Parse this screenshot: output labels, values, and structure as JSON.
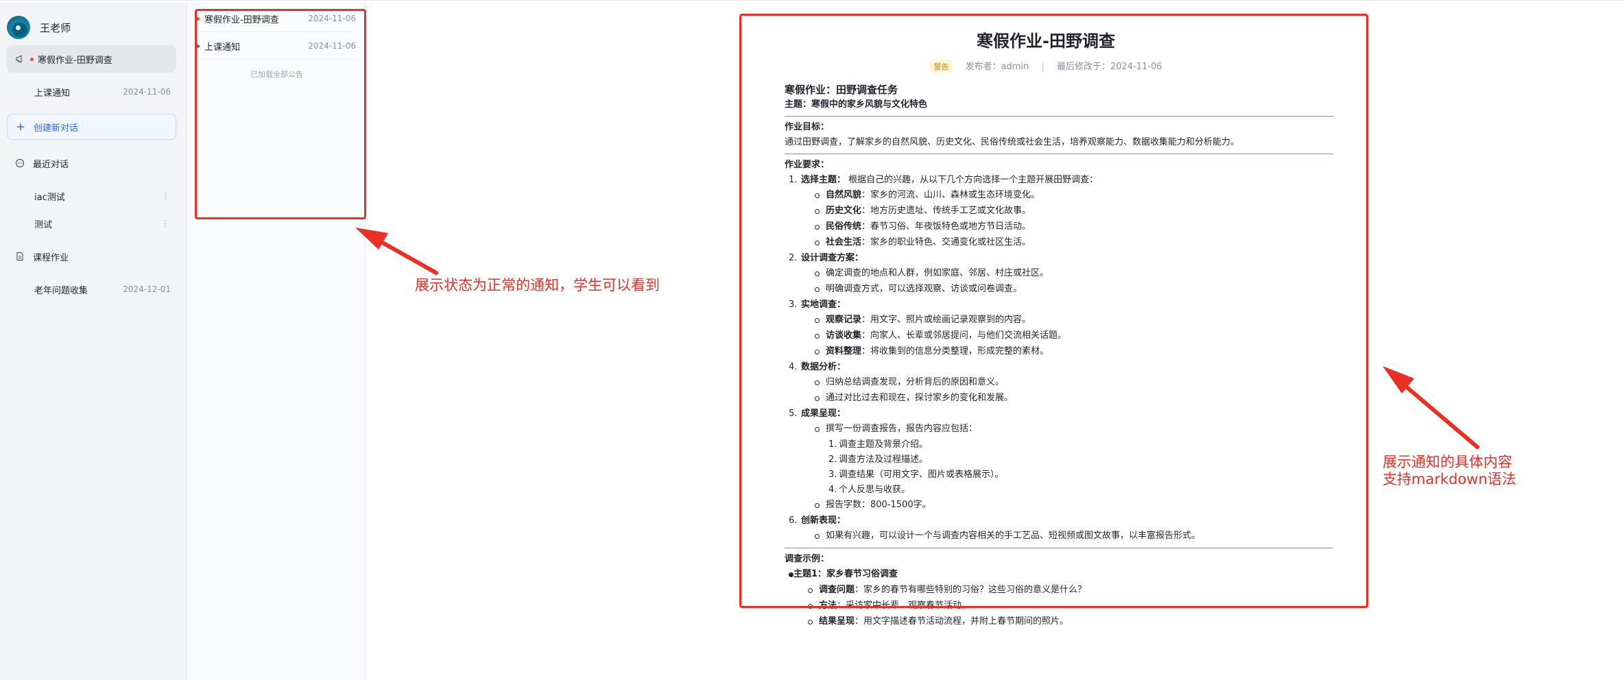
{
  "user": {
    "name": "王老师"
  },
  "sidebar": {
    "active_notice": {
      "label": "寒假作业-田野调查"
    },
    "notice_2": {
      "label": "上课通知",
      "date": "2024-11-06"
    },
    "new_chat": {
      "label": "创建新对话"
    },
    "recent": {
      "label": "最近对话"
    },
    "chats": [
      {
        "label": "iac测试"
      },
      {
        "label": "测试"
      }
    ],
    "homework": {
      "label": "课程作业"
    },
    "homework_item": {
      "label": "老年问题收集",
      "date": "2024-12-01"
    }
  },
  "notice_list": {
    "items": [
      {
        "title": "寒假作业-田野调查",
        "date": "2024-11-06",
        "dot_color": "#f04a2a"
      },
      {
        "title": "上课通知",
        "date": "2024-11-06",
        "dot_color": "#2f6bf1"
      }
    ],
    "loaded_text": "已加载全部公告"
  },
  "doc": {
    "title": "寒假作业-田野调查",
    "tag": "警告",
    "publisher": "发布者：admin",
    "modified": "最后修改于：2024-11-06",
    "h_task": "寒假作业：田野调查任务",
    "subject": "主题：寒假中的家乡风貌与文化特色",
    "goal_label": "作业目标：",
    "goal_text": "通过田野调查，了解家乡的自然风貌、历史文化、民俗传统或社会生活，培养观察能力、数据收集能力和分析能力。",
    "req_label": "作业要求：",
    "s1": {
      "num": "1.",
      "title": "选择主题：",
      "text": " 根据自己的兴趣，从以下几个方向选择一个主题开展田野调查：",
      "items": [
        {
          "b": "自然风貌",
          "t": "：家乡的河流、山川、森林或生态环境变化。"
        },
        {
          "b": "历史文化",
          "t": "：地方历史遗址、传统手工艺或文化故事。"
        },
        {
          "b": "民俗传统",
          "t": "：春节习俗、年夜饭特色或地方节日活动。"
        },
        {
          "b": "社会生活",
          "t": "：家乡的职业特色、交通变化或社区生活。"
        }
      ]
    },
    "s2": {
      "num": "2.",
      "title": "设计调查方案：",
      "items": [
        "确定调查的地点和人群，例如家庭、邻居、村庄或社区。",
        "明确调查方式，可以选择观察、访谈或问卷调查。"
      ]
    },
    "s3": {
      "num": "3.",
      "title": "实地调查：",
      "items": [
        {
          "b": "观察记录",
          "t": "：用文字、照片或绘画记录观察到的内容。"
        },
        {
          "b": "访谈收集",
          "t": "：向家人、长辈或邻居提问，与他们交流相关话题。"
        },
        {
          "b": "资料整理",
          "t": "：将收集到的信息分类整理，形成完整的素材。"
        }
      ]
    },
    "s4": {
      "num": "4.",
      "title": "数据分析：",
      "items": [
        "归纳总结调查发现，分析背后的原因和意义。",
        "通过对比过去和现在，探讨家乡的变化和发展。"
      ]
    },
    "s5": {
      "num": "5.",
      "title": "成果呈现：",
      "intro": "撰写一份调查报告，报告内容应包括：",
      "sub": [
        {
          "num": "1.",
          "t": "调查主题及背景介绍。"
        },
        {
          "num": "2.",
          "t": "调查方法及过程描述。"
        },
        {
          "num": "3.",
          "t": "调查结果（可用文字、图片或表格展示）。"
        },
        {
          "num": "4.",
          "t": "个人反思与收获。"
        }
      ],
      "count": "报告字数：800-1500字。"
    },
    "s6": {
      "num": "6.",
      "title": "创新表现：",
      "items": [
        "如果有兴趣，可以设计一个与调查内容相关的手工艺品、短视频或图文故事，以丰富报告形式。"
      ]
    },
    "example_label": "调查示例：",
    "example_topic": "主题1：家乡春节习俗调查",
    "example_items": [
      {
        "b": "调查问题",
        "t": "：家乡的春节有哪些特别的习俗？这些习俗的意义是什么？"
      },
      {
        "b": "方法",
        "t": "：采访家中长辈、观察春节活动。"
      },
      {
        "b": "结果呈现",
        "t": "：用文字描述春节活动流程，并附上春节期间的照片。"
      }
    ]
  },
  "annotations": {
    "left_note": "展示状态为正常的通知，学生可以看到",
    "right_note_1": "展示通知的具体内容",
    "right_note_2": "支持markdown语法"
  },
  "colors": {
    "accent": "#2f6bf1",
    "annotation_red": "#ea2f23",
    "warning_tag": "#d08a00"
  }
}
